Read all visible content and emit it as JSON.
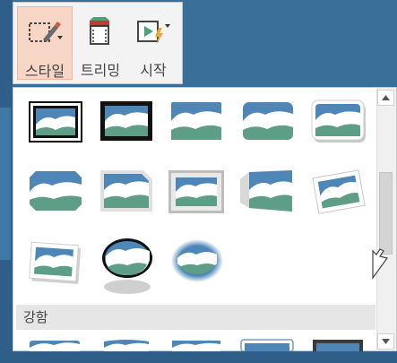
{
  "ribbon": {
    "buttons": [
      {
        "label": "스타일",
        "icon": "picture-style-icon",
        "active": true
      },
      {
        "label": "트리밍",
        "icon": "trim-video-icon",
        "active": false
      },
      {
        "label": "시작",
        "icon": "start-playback-icon",
        "active": false
      }
    ]
  },
  "gallery": {
    "section_header": "강함",
    "styles_row1": [
      "simple-black-frame",
      "thick-black-frame",
      "soft-edge-rectangle",
      "rounded-rectangle",
      "drop-shadow-rounded"
    ],
    "styles_row2": [
      "bevel-rounded-corners",
      "snip-corner",
      "metal-frame",
      "perspective-left",
      "rotated-white-frame"
    ],
    "styles_row3": [
      "rotated-shadow",
      "oval-black-frame",
      "soft-edge-oval"
    ],
    "styles_row4": [
      "intense-1",
      "intense-2",
      "intense-3",
      "intense-4",
      "intense-5"
    ]
  },
  "colors": {
    "sky": "#4f86b8",
    "hill": "#5e9e86",
    "active_button_bg": "#f7d6c5"
  }
}
